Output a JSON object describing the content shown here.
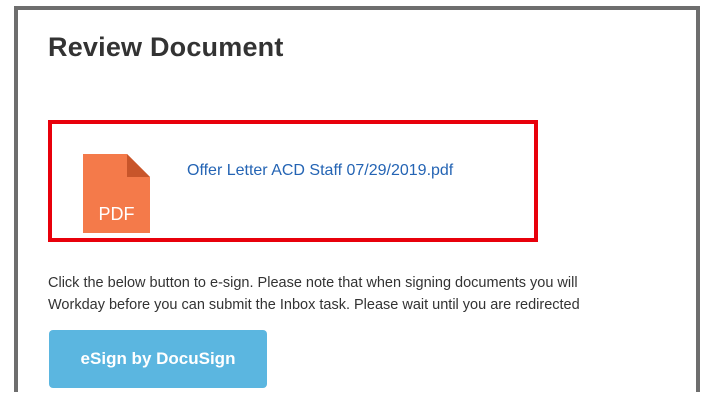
{
  "header": {
    "title": "Review Document"
  },
  "document": {
    "icon": "pdf-file-icon",
    "icon_label": "PDF",
    "icon_color": "#f47a4a",
    "filename": "Offer Letter ACD Staff 07/29/2019.pdf",
    "highlight_color": "#e8000b"
  },
  "instructions": {
    "line1": "Click the below button to e-sign. Please note that when signing documents you will",
    "line2": "Workday before you can submit the Inbox task. Please wait until you are redirected"
  },
  "actions": {
    "esign_label": "eSign by DocuSign",
    "esign_color": "#5bb6e0"
  }
}
